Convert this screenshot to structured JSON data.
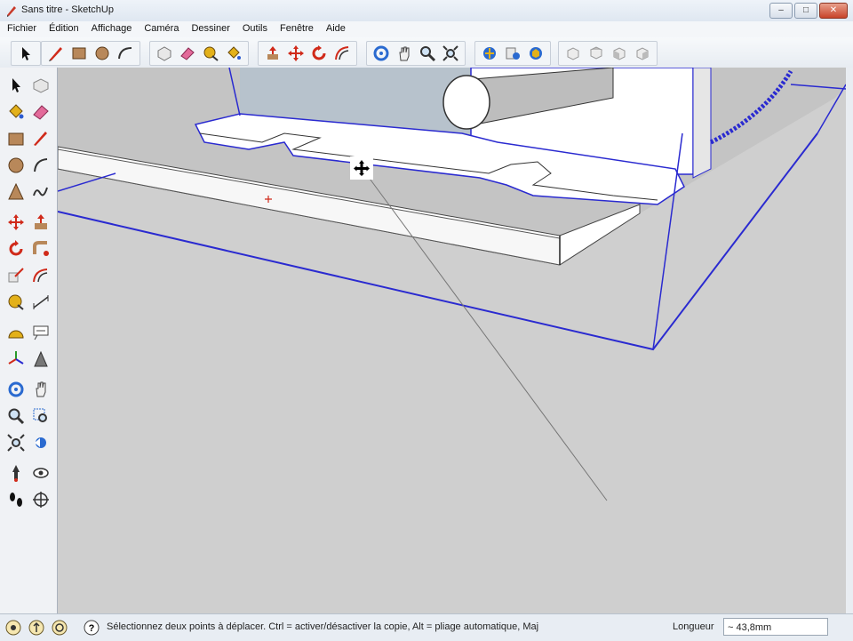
{
  "window": {
    "title": "Sans titre - SketchUp",
    "buttons": [
      "–",
      "□",
      "✕"
    ]
  },
  "menu": [
    "Fichier",
    "Édition",
    "Affichage",
    "Caméra",
    "Dessiner",
    "Outils",
    "Fenêtre",
    "Aide"
  ],
  "toolbar": {
    "groups": [
      [
        "select-arrow-icon"
      ],
      [
        "pencil-line-icon",
        "rectangle-icon",
        "circle-icon",
        "arc-icon"
      ],
      [
        "make-component-icon",
        "eraser-icon",
        "tape-measure-icon",
        "paint-bucket-icon"
      ],
      [
        "push-pull-icon",
        "move-icon",
        "rotate-icon",
        "offset-icon"
      ],
      [
        "orbit-icon",
        "pan-icon",
        "zoom-icon",
        "zoom-extents-icon"
      ],
      [
        "get-models-icon",
        "share-model-icon",
        "share-component-icon"
      ],
      [
        "iso-view-icon",
        "top-view-icon",
        "front-view-icon",
        "right-view-icon"
      ]
    ]
  },
  "left_tools": [
    "select-arrow-icon",
    "make-component-icon",
    "paint-bucket-icon",
    "eraser-icon",
    "rectangle-icon",
    "pencil-line-icon",
    "circle-icon",
    "arc-icon",
    "polygon-icon",
    "freehand-icon",
    "move-icon",
    "push-pull-icon",
    "rotate-icon",
    "follow-me-icon",
    "scale-icon",
    "offset-icon",
    "tape-measure-icon",
    "dimension-icon",
    "protractor-icon",
    "text-label-icon",
    "axes-icon",
    "3d-text-icon",
    "orbit-icon",
    "pan-icon",
    "zoom-icon",
    "zoom-window-icon",
    "zoom-extents-icon",
    "previous-view-icon",
    "position-camera-icon",
    "look-around-icon",
    "walk-icon",
    "section-plane-icon"
  ],
  "status": {
    "icons": [
      "geolocation-icon",
      "credits-icon",
      "user-icon",
      "help-icon"
    ],
    "message": "Sélectionnez deux points à déplacer.  Ctrl = activer/désactiver la copie, Alt = pliage automatique, Maj",
    "measure_label": "Longueur",
    "measure_value": "~ 43,8mm"
  },
  "colors": {
    "edge_blue": "#2a2ad0",
    "ground": "#cfcfcf",
    "face": "#ffffff"
  }
}
